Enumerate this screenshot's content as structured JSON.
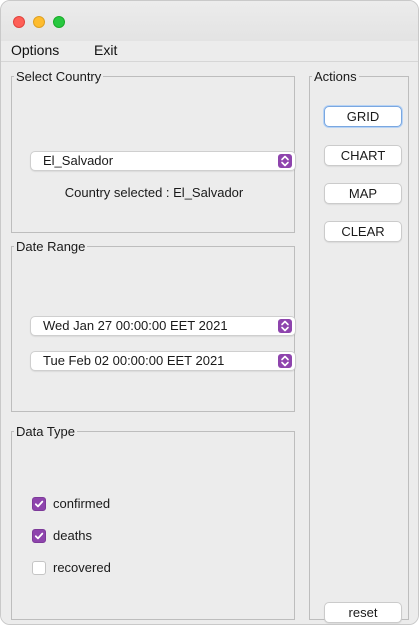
{
  "menu": {
    "options": "Options",
    "exit": "Exit"
  },
  "country_panel": {
    "legend": "Select Country",
    "selected": "El_Salvador",
    "status": "Country selected : El_Salvador"
  },
  "date_panel": {
    "legend": "Date Range",
    "from": "Wed Jan 27 00:00:00 EET 2021",
    "to": "Tue Feb 02 00:00:00 EET 2021"
  },
  "type_panel": {
    "legend": "Data Type",
    "options": [
      {
        "label": "confirmed",
        "checked": true
      },
      {
        "label": "deaths",
        "checked": true
      },
      {
        "label": "recovered",
        "checked": false
      }
    ]
  },
  "actions_panel": {
    "legend": "Actions",
    "grid": "GRID",
    "chart": "CHART",
    "map": "MAP",
    "clear": "CLEAR",
    "reset": "reset"
  },
  "colors": {
    "accent": "#8e44ad",
    "close": "#fe5f57",
    "minimize": "#febc2e",
    "maximize": "#28c840",
    "focus_ring": "#7aa7e0"
  },
  "icons": {
    "select_arrow": "updown-chevron-icon",
    "check": "checkmark-icon"
  }
}
